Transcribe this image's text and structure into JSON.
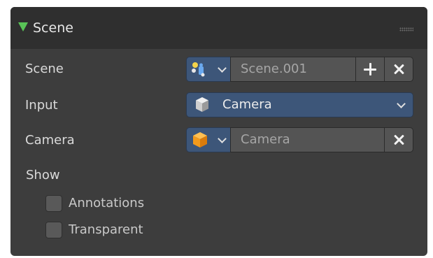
{
  "panel": {
    "title": "Scene",
    "accent_color": "#59c457"
  },
  "rows": {
    "scene": {
      "label": "Scene",
      "icon": "scene-data-icon",
      "value": "Scene.001",
      "add_label": "+",
      "remove_label": "×"
    },
    "input": {
      "label": "Input",
      "icon": "cube-object-icon",
      "value": "Camera"
    },
    "camera": {
      "label": "Camera",
      "icon": "camera-object-icon",
      "value": "Camera",
      "remove_label": "×"
    }
  },
  "show": {
    "label": "Show",
    "annotations_label": "Annotations",
    "annotations_checked": false,
    "transparent_label": "Transparent",
    "transparent_checked": false
  },
  "colors": {
    "panel_bg": "#3d3d3d",
    "header_bg": "#2f2f2f",
    "field_bg": "#545454",
    "selected_field_bg": "#3d5679"
  }
}
